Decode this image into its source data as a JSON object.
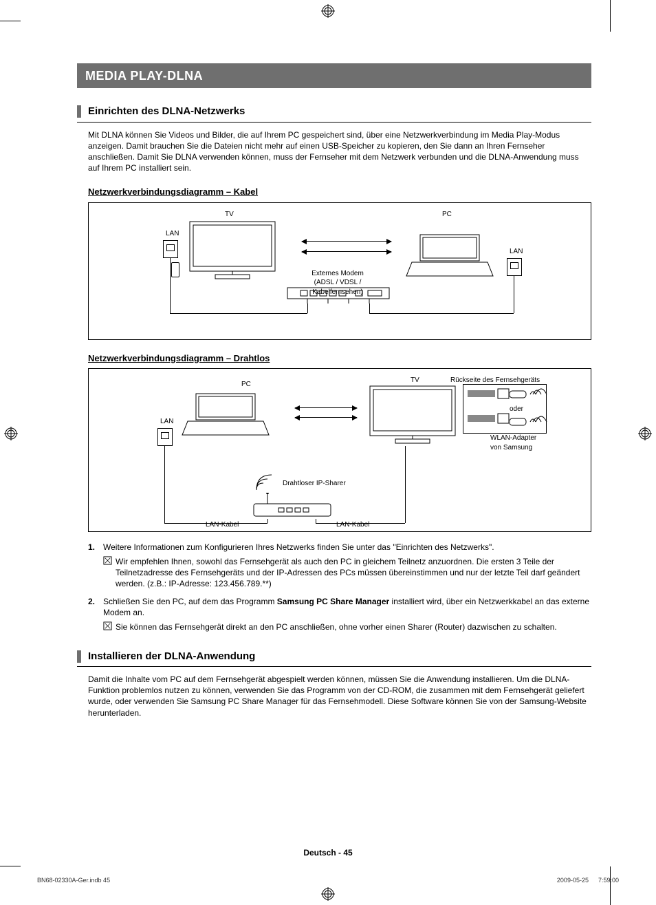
{
  "banner": "MEDIA PLAY-DLNA",
  "section1": {
    "heading": "Einrichten des DLNA-Netzwerks",
    "intro": "Mit DLNA können Sie Videos und Bilder, die auf Ihrem PC gespeichert sind, über eine Netzwerkverbindung im Media Play-Modus anzeigen. Damit brauchen Sie die Dateien nicht mehr auf einen USB-Speicher zu kopieren, den Sie dann an Ihren Fernseher anschließen. Damit Sie DLNA verwenden können, muss der Fernseher mit dem Netzwerk verbunden und die DLNA-Anwendung muss auf Ihrem PC installiert sein.",
    "diag1_title": "Netzwerkverbindungsdiagramm – Kabel",
    "diag2_title": "Netzwerkverbindungsdiagramm – Drahtlos"
  },
  "diag1": {
    "tv": "TV",
    "pc": "PC",
    "lan1": "LAN",
    "lan2": "LAN",
    "modem_l1": "Externes Modem",
    "modem_l2": "(ADSL / VDSL / Kabelfernsehen)"
  },
  "diag2": {
    "pc": "PC",
    "tv": "TV",
    "lan": "LAN",
    "back": "Rückseite des Fernsehgeräts",
    "or": "oder",
    "wlan_l1": "WLAN-Adapter",
    "wlan_l2": "von Samsung",
    "router": "Drahtloser IP-Sharer",
    "lan_cable1": "LAN-Kabel",
    "lan_cable2": "LAN-Kabel"
  },
  "list": {
    "n1": "1.",
    "t1": "Weitere Informationen zum Konfigurieren Ihres Netzwerks finden Sie unter das \"Einrichten des Netzwerks\".",
    "note1": "Wir empfehlen Ihnen, sowohl das Fernsehgerät als auch den PC in gleichem Teilnetz anzuordnen. Die ersten 3 Teile der Teilnetzadresse des Fernsehgeräts und der IP-Adressen des PCs müssen übereinstimmen und nur der letzte Teil darf geändert werden. (z.B.: IP-Adresse: 123.456.789.**)",
    "n2": "2.",
    "t2a": "Schließen Sie den PC, auf dem das Programm ",
    "t2b": "Samsung PC Share Manager",
    "t2c": " installiert wird, über ein Netzwerkkabel an das externe Modem an.",
    "note2": "Sie können das Fernsehgerät direkt an den PC anschließen, ohne vorher einen Sharer (Router) dazwischen zu schalten."
  },
  "section2": {
    "heading": "Installieren der DLNA-Anwendung",
    "para": "Damit die Inhalte vom PC auf dem Fernsehgerät abgespielt werden können, müssen Sie die Anwendung installieren. Um die DLNA-Funktion problemlos nutzen zu können, verwenden Sie das Programm von der CD-ROM, die zusammen mit dem Fernsehgerät geliefert wurde, oder verwenden Sie Samsung PC Share Manager für das Fernsehmodell. Diese Software können Sie von der Samsung-Website herunterladen."
  },
  "footer": "Deutsch - 45",
  "print_left": "BN68-02330A-Ger.indb   45",
  "print_right": "2009-05-25      7:59:00"
}
